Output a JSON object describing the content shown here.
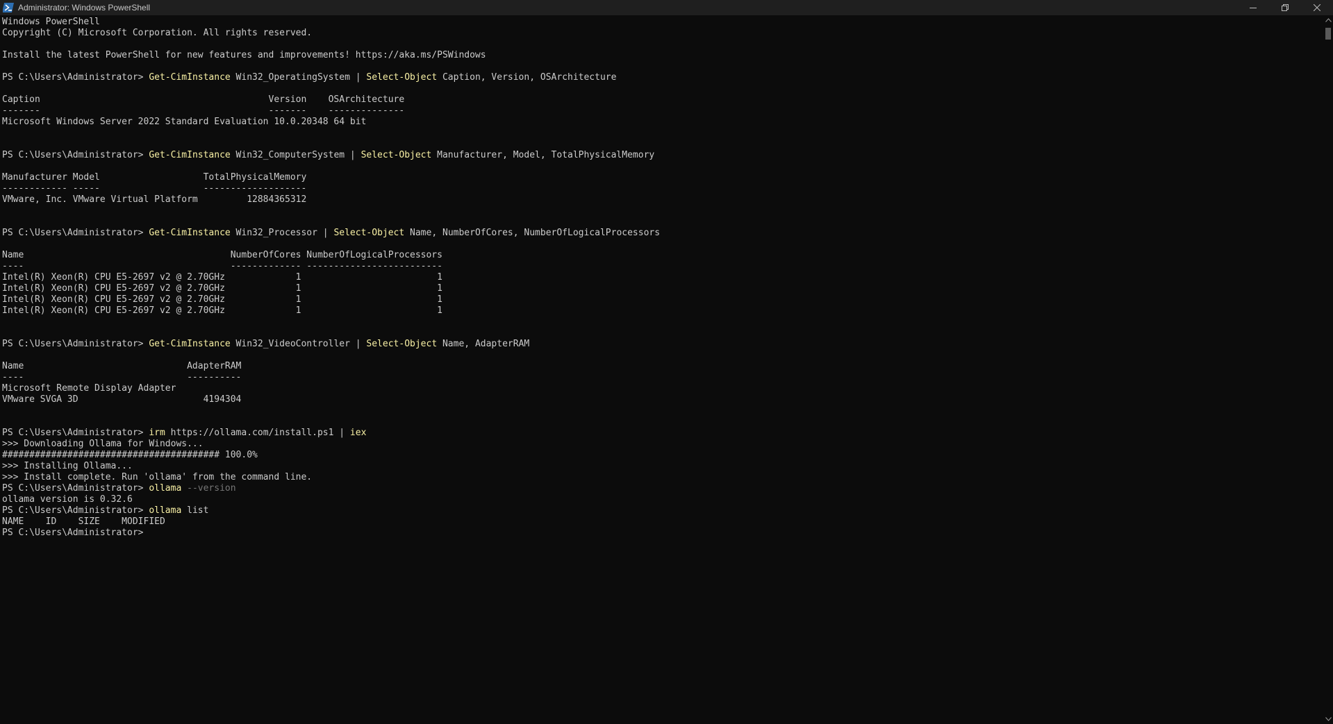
{
  "window": {
    "title": "Administrator: Windows PowerShell",
    "icon": "powershell-icon",
    "controls": [
      "minimize-icon",
      "restore-icon",
      "close-icon"
    ]
  },
  "colors": {
    "background": "#0c0c0c",
    "text": "#cccccc",
    "command": "#f9f1a5",
    "parameter": "#767676",
    "titlebar": "#1f1f1f"
  },
  "console": {
    "lines": [
      {
        "text": "Windows PowerShell"
      },
      {
        "text": "Copyright (C) Microsoft Corporation. All rights reserved."
      },
      {
        "text": ""
      },
      {
        "text": "Install the latest PowerShell for new features and improvements! https://aka.ms/PSWindows"
      },
      {
        "text": ""
      },
      {
        "prompt": "PS C:\\Users\\Administrator> ",
        "segments": [
          {
            "text": "Get-CimInstance",
            "type": "cmd"
          },
          {
            "text": " Win32_OperatingSystem | ",
            "type": "arg"
          },
          {
            "text": "Select-Object",
            "type": "cmd"
          },
          {
            "text": " Caption, Version, OSArchitecture",
            "type": "arg"
          }
        ]
      },
      {
        "text": ""
      },
      {
        "text": "Caption                                          Version    OSArchitecture"
      },
      {
        "text": "-------                                          -------    --------------"
      },
      {
        "text": "Microsoft Windows Server 2022 Standard Evaluation 10.0.20348 64 bit"
      },
      {
        "text": ""
      },
      {
        "text": ""
      },
      {
        "prompt": "PS C:\\Users\\Administrator> ",
        "segments": [
          {
            "text": "Get-CimInstance",
            "type": "cmd"
          },
          {
            "text": " Win32_ComputerSystem | ",
            "type": "arg"
          },
          {
            "text": "Select-Object",
            "type": "cmd"
          },
          {
            "text": " Manufacturer, Model, TotalPhysicalMemory",
            "type": "arg"
          }
        ]
      },
      {
        "text": ""
      },
      {
        "text": "Manufacturer Model                   TotalPhysicalMemory"
      },
      {
        "text": "------------ -----                   -------------------"
      },
      {
        "text": "VMware, Inc. VMware Virtual Platform         12884365312"
      },
      {
        "text": ""
      },
      {
        "text": ""
      },
      {
        "prompt": "PS C:\\Users\\Administrator> ",
        "segments": [
          {
            "text": "Get-CimInstance",
            "type": "cmd"
          },
          {
            "text": " Win32_Processor | ",
            "type": "arg"
          },
          {
            "text": "Select-Object",
            "type": "cmd"
          },
          {
            "text": " Name, NumberOfCores, NumberOfLogicalProcessors",
            "type": "arg"
          }
        ]
      },
      {
        "text": ""
      },
      {
        "text": "Name                                      NumberOfCores NumberOfLogicalProcessors"
      },
      {
        "text": "----                                      ------------- -------------------------"
      },
      {
        "text": "Intel(R) Xeon(R) CPU E5-2697 v2 @ 2.70GHz             1                         1"
      },
      {
        "text": "Intel(R) Xeon(R) CPU E5-2697 v2 @ 2.70GHz             1                         1"
      },
      {
        "text": "Intel(R) Xeon(R) CPU E5-2697 v2 @ 2.70GHz             1                         1"
      },
      {
        "text": "Intel(R) Xeon(R) CPU E5-2697 v2 @ 2.70GHz             1                         1"
      },
      {
        "text": ""
      },
      {
        "text": ""
      },
      {
        "prompt": "PS C:\\Users\\Administrator> ",
        "segments": [
          {
            "text": "Get-CimInstance",
            "type": "cmd"
          },
          {
            "text": " Win32_VideoController | ",
            "type": "arg"
          },
          {
            "text": "Select-Object",
            "type": "cmd"
          },
          {
            "text": " Name, AdapterRAM",
            "type": "arg"
          }
        ]
      },
      {
        "text": ""
      },
      {
        "text": "Name                              AdapterRAM"
      },
      {
        "text": "----                              ----------"
      },
      {
        "text": "Microsoft Remote Display Adapter"
      },
      {
        "text": "VMware SVGA 3D                       4194304"
      },
      {
        "text": ""
      },
      {
        "text": ""
      },
      {
        "prompt": "PS C:\\Users\\Administrator> ",
        "segments": [
          {
            "text": "irm",
            "type": "cmd"
          },
          {
            "text": " https://ollama.com/install.ps1 | ",
            "type": "arg"
          },
          {
            "text": "iex",
            "type": "cmd"
          }
        ]
      },
      {
        "text": ">>> Downloading Ollama for Windows..."
      },
      {
        "text": "######################################## 100.0%"
      },
      {
        "text": ">>> Installing Ollama..."
      },
      {
        "text": ">>> Install complete. Run 'ollama' from the command line."
      },
      {
        "prompt": "PS C:\\Users\\Administrator> ",
        "segments": [
          {
            "text": "ollama",
            "type": "cmd"
          },
          {
            "text": " --version",
            "type": "param"
          }
        ]
      },
      {
        "text": "ollama version is 0.32.6"
      },
      {
        "prompt": "PS C:\\Users\\Administrator> ",
        "segments": [
          {
            "text": "ollama",
            "type": "cmd"
          },
          {
            "text": " list",
            "type": "arg"
          }
        ]
      },
      {
        "text": "NAME    ID    SIZE    MODIFIED"
      },
      {
        "prompt": "PS C:\\Users\\Administrator> ",
        "segments": []
      }
    ]
  }
}
